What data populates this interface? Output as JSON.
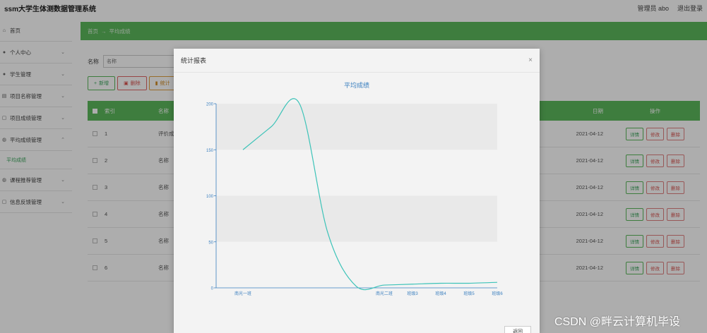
{
  "header": {
    "title": "ssm大学生体测数据管理系统",
    "user": "管理员 abo",
    "logout": "退出登录"
  },
  "sidebar": {
    "items": [
      {
        "icon": "home-icon",
        "label": "首页",
        "chevron": false
      },
      {
        "icon": "user-icon",
        "label": "个人中心",
        "chevron": true
      },
      {
        "icon": "user-icon",
        "label": "学生管理",
        "chevron": true
      },
      {
        "icon": "list-icon",
        "label": "项目名称管理",
        "chevron": true
      },
      {
        "icon": "doc-icon",
        "label": "项目成绩管理",
        "chevron": true
      },
      {
        "icon": "globe-icon",
        "label": "平均成绩管理",
        "chevron": true,
        "expanded": true,
        "sub": "平均成绩"
      },
      {
        "icon": "globe-icon",
        "label": "课程推荐管理",
        "chevron": true
      },
      {
        "icon": "doc-icon",
        "label": "信息反馈管理",
        "chevron": true
      }
    ]
  },
  "breadcrumb": {
    "home": "首页",
    "sep": "→",
    "current": "平均成绩"
  },
  "search": {
    "label": "名称",
    "placeholder": "名称"
  },
  "buttons": {
    "add": "新增",
    "delete": "删除",
    "stats": "统计"
  },
  "table": {
    "headers": {
      "idx": "索引",
      "name": "名称",
      "date": "日期",
      "ops": "操作"
    },
    "rows": [
      {
        "idx": "1",
        "name": "评价成绩",
        "date": "2021-04-12"
      },
      {
        "idx": "2",
        "name": "名称",
        "date": "2021-04-12"
      },
      {
        "idx": "3",
        "name": "名称",
        "date": "2021-04-12"
      },
      {
        "idx": "4",
        "name": "名称",
        "date": "2021-04-12"
      },
      {
        "idx": "5",
        "name": "名称",
        "date": "2021-04-12"
      },
      {
        "idx": "6",
        "name": "名称",
        "date": "2021-04-12"
      }
    ],
    "ops": {
      "detail": "详情",
      "edit": "修改",
      "delete": "删除"
    }
  },
  "modal": {
    "title": "统计报表",
    "close": "×",
    "footer_btn": "返回"
  },
  "chart_data": {
    "type": "line",
    "title": "平均成绩",
    "categories": [
      "南光一班",
      "",
      "",
      "",
      "",
      "南光二班",
      "班级3",
      "班级4",
      "班级5",
      "班级6"
    ],
    "values": [
      150,
      175,
      200,
      60,
      2,
      3,
      4,
      5,
      5,
      6
    ],
    "ylim": [
      0,
      200
    ],
    "yticks": [
      0,
      50,
      100,
      150,
      200
    ],
    "color": "#3cc3b8",
    "axis_color": "#3a7fbf"
  },
  "watermark": "CSDN @畔云计算机毕设"
}
